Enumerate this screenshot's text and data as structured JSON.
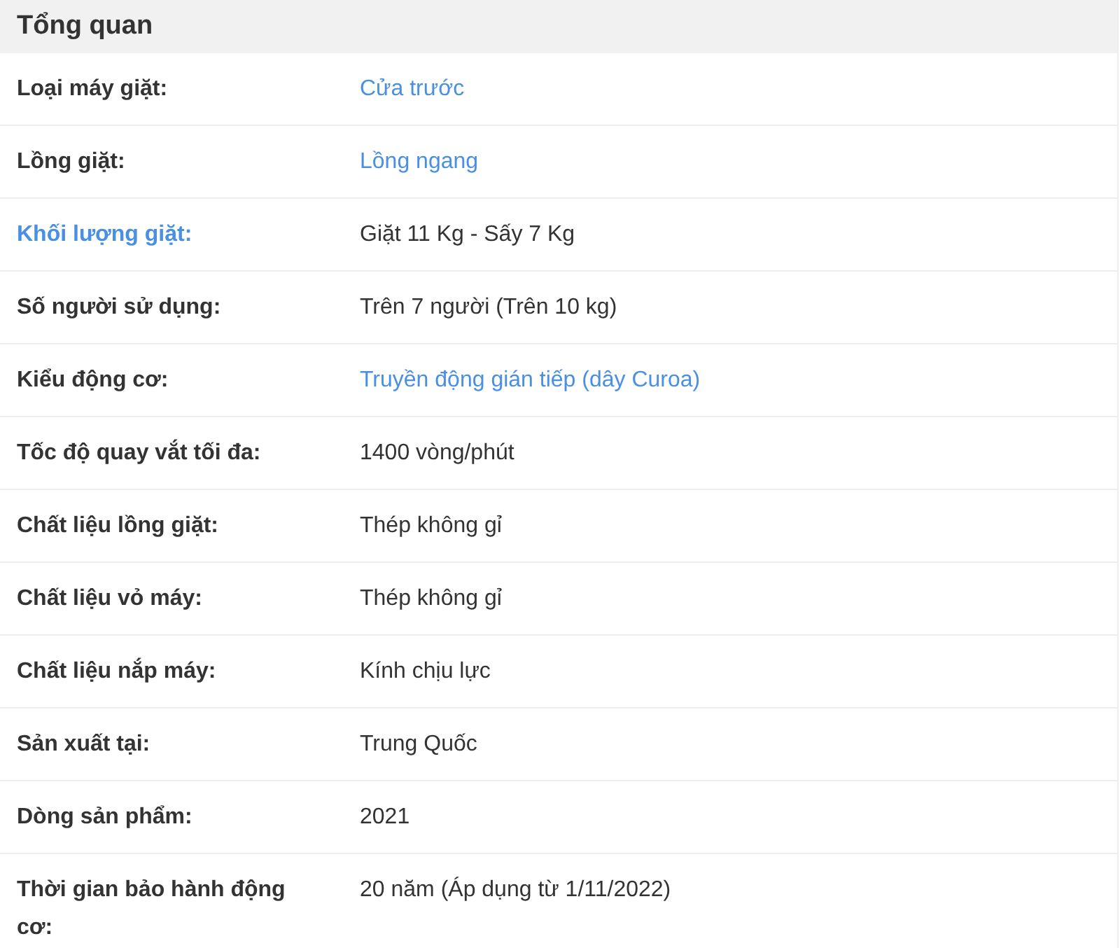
{
  "section": {
    "title": "Tổng quan"
  },
  "rows": [
    {
      "label": "Loại máy giặt:",
      "label_link": false,
      "value": "Cửa trước",
      "value_link": true
    },
    {
      "label": "Lồng giặt:",
      "label_link": false,
      "value": "Lồng ngang",
      "value_link": true
    },
    {
      "label": "Khối lượng giặt:",
      "label_link": true,
      "value": "Giặt 11 Kg - Sấy 7 Kg",
      "value_link": false
    },
    {
      "label": "Số người sử dụng:",
      "label_link": false,
      "value": "Trên 7 người (Trên 10 kg)",
      "value_link": false
    },
    {
      "label": "Kiểu động cơ:",
      "label_link": false,
      "value": "Truyền động gián tiếp (dây Curoa)",
      "value_link": true
    },
    {
      "label": "Tốc độ quay vắt tối đa:",
      "label_link": false,
      "value": "1400 vòng/phút",
      "value_link": false
    },
    {
      "label": "Chất liệu lồng giặt:",
      "label_link": false,
      "value": "Thép không gỉ",
      "value_link": false
    },
    {
      "label": "Chất liệu vỏ máy:",
      "label_link": false,
      "value": "Thép không gỉ",
      "value_link": false
    },
    {
      "label": "Chất liệu nắp máy:",
      "label_link": false,
      "value": "Kính chịu lực",
      "value_link": false
    },
    {
      "label": "Sản xuất tại:",
      "label_link": false,
      "value": "Trung Quốc",
      "value_link": false
    },
    {
      "label": "Dòng sản phẩm:",
      "label_link": false,
      "value": "2021",
      "value_link": false
    },
    {
      "label": "Thời gian bảo hành động cơ:",
      "label_link": false,
      "value": "20 năm (Áp dụng từ 1/11/2022)",
      "value_link": false
    }
  ]
}
